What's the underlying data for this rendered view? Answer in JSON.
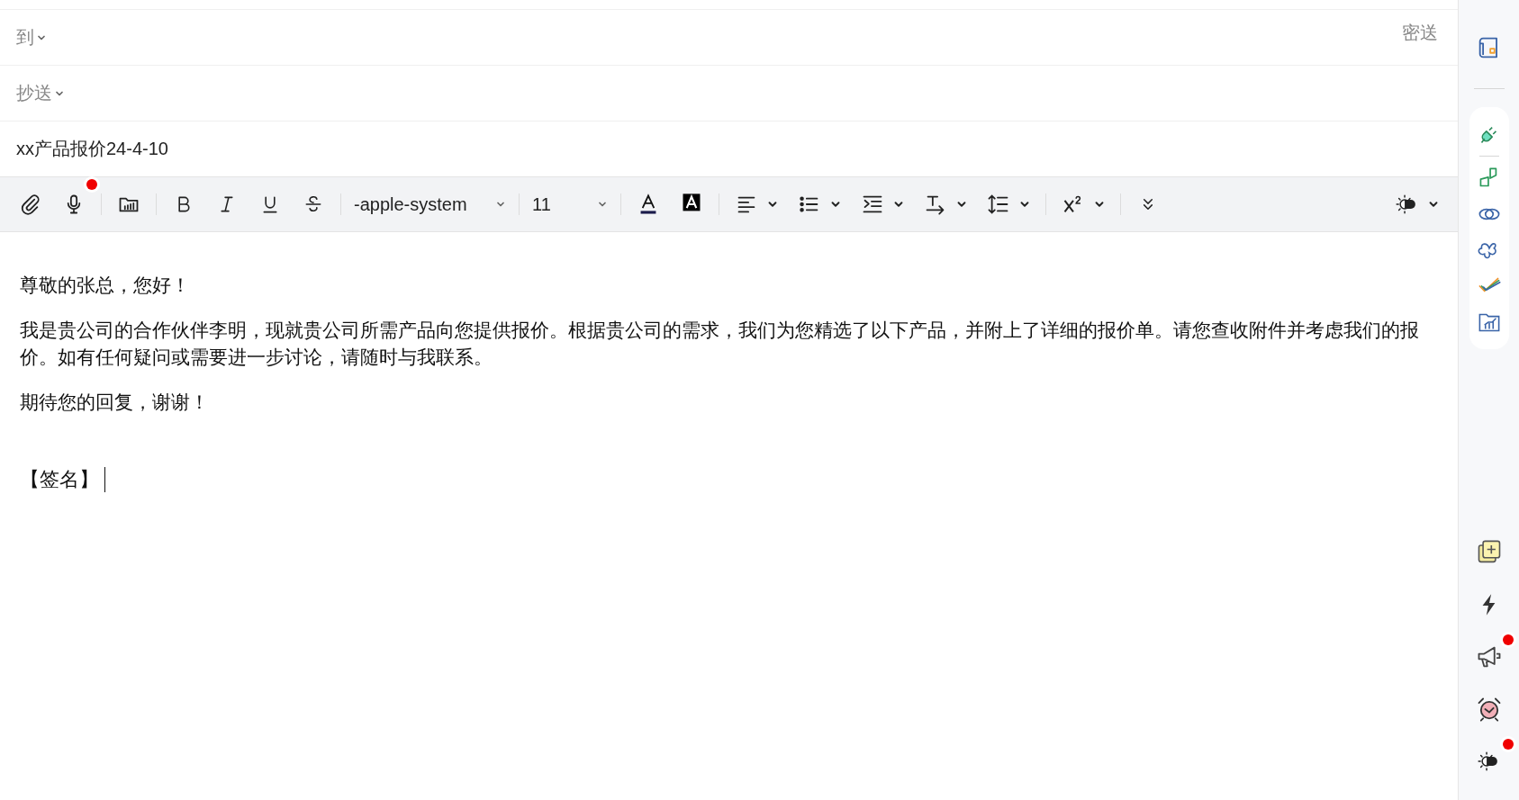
{
  "compose": {
    "to": {
      "label": "到"
    },
    "bcc": {
      "label": "密送"
    },
    "cc": {
      "label": "抄送"
    },
    "subject": {
      "value": "xx产品报价24-4-10"
    }
  },
  "toolbar": {
    "voice_notification": true,
    "font": {
      "value": "-apple-system"
    },
    "size": {
      "value": "11"
    }
  },
  "body": {
    "paragraphs": [
      "尊敬的张总，您好！",
      "我是贵公司的合作伙伴李明，现就贵公司所需产品向您提供报价。根据贵公司的需求，我们为您精选了以下产品，并附上了详细的报价单。请您查收附件并考虑我们的报价。如有任何疑问或需要进一步讨论，请随时与我联系。",
      "期待您的回复，谢谢！"
    ],
    "signature": "【签名】"
  },
  "sidebar": {
    "announcements_notification": true,
    "theme_notification": true
  }
}
